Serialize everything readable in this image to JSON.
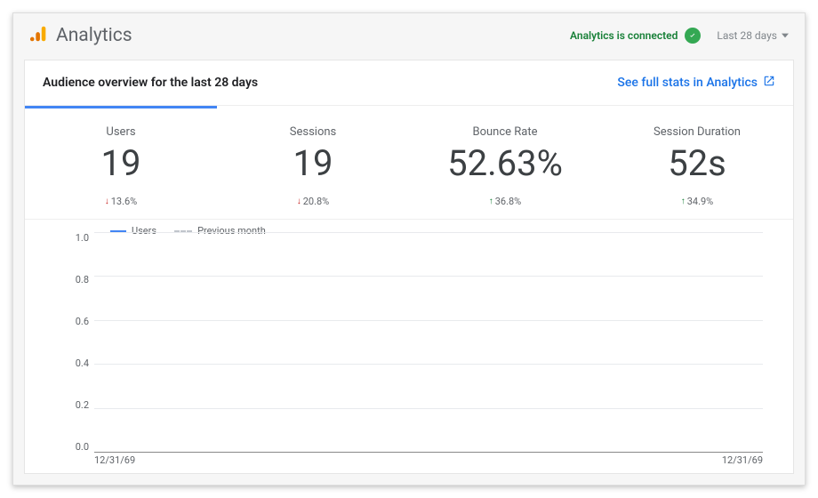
{
  "brand": {
    "name": "Analytics"
  },
  "topbar": {
    "connected_label": "Analytics is connected",
    "range_label": "Last 28 days"
  },
  "panel": {
    "title": "Audience overview for the last 28 days",
    "link_label": "See full stats in Analytics"
  },
  "metrics": [
    {
      "label": "Users",
      "value": "19",
      "delta": "13.6%",
      "dir": "down",
      "active": true
    },
    {
      "label": "Sessions",
      "value": "19",
      "delta": "20.8%",
      "dir": "down",
      "active": false
    },
    {
      "label": "Bounce Rate",
      "value": "52.63%",
      "delta": "36.8%",
      "dir": "up",
      "active": false
    },
    {
      "label": "Session Duration",
      "value": "52s",
      "delta": "34.9%",
      "dir": "up",
      "active": false
    }
  ],
  "chart": {
    "legend_current": "Users",
    "legend_prev": "Previous month",
    "y_ticks": [
      "1.0",
      "0.8",
      "0.6",
      "0.4",
      "0.2",
      "0.0"
    ],
    "x_start": "12/31/69",
    "x_end": "12/31/69"
  },
  "chart_data": {
    "type": "line",
    "title": "Users",
    "ylabel": "",
    "xlabel": "",
    "ylim": [
      0,
      1.0
    ],
    "x_range": [
      "12/31/69",
      "12/31/69"
    ],
    "series": [
      {
        "name": "Users",
        "values": []
      },
      {
        "name": "Previous month",
        "values": []
      }
    ]
  }
}
